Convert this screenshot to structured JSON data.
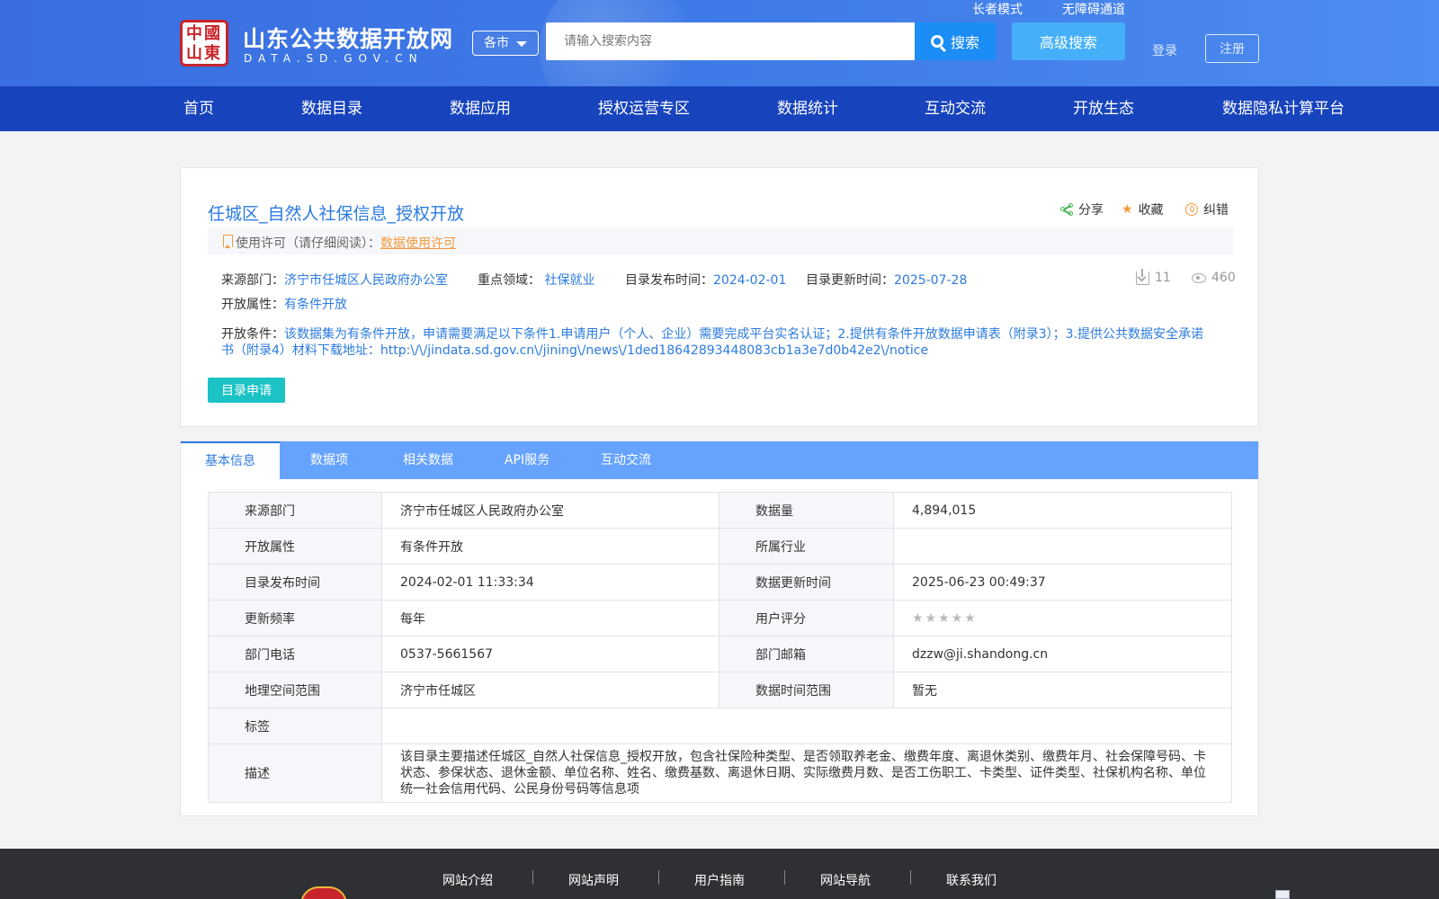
{
  "header": {
    "site_title": "山东公共数据开放网",
    "site_domain": "DATA.SD.GOV.CN",
    "logo_text": "中國山東",
    "city_select": "各市",
    "search_placeholder": "请输入搜索内容",
    "search_button": "搜索",
    "advanced_search": "高级搜索",
    "elder_mode": "长者模式",
    "accessibility": "无障碍通道",
    "login": "登录",
    "register": "注册",
    "brand_color": "#3f7ce8"
  },
  "nav": {
    "items": [
      "首页",
      "数据目录",
      "数据应用",
      "授权运营专区",
      "数据统计",
      "互动交流",
      "开放生态",
      "数据隐私计算平台"
    ],
    "color": "#1743bc"
  },
  "dataset": {
    "title": "任城区_自然人社保信息_授权开放",
    "actions": {
      "share": "分享",
      "favorite": "收藏",
      "report": "纠错"
    },
    "license_label": "使用许可（请仔细阅读）：",
    "license_link": "数据使用许可",
    "source_label": "来源部门：",
    "source_value": "济宁市任城区人民政府办公室",
    "domain_label": "重点领域：",
    "domain_value": "社保就业",
    "publish_label": "目录发布时间：",
    "publish_value": "2024-02-01",
    "update_label": "目录更新时间：",
    "update_value": "2025-07-28",
    "downloads": "11",
    "views": "460",
    "open_attr_label": "开放属性：",
    "open_attr_value": "有条件开放",
    "condition_label": "开放条件：",
    "condition_value": "该数据集为有条件开放，申请需要满足以下条件1.申请用户（个人、企业）需要完成平台实名认证；2.提供有条件开放数据申请表（附录3）；3.提供公共数据安全承诺书（附录4）材料下载地址：http:\\/\\/jindata.sd.gov.cn\\/jining\\/news\\/1ded18642893448083cb1a3e7d0b42e2\\/notice",
    "apply_button": "目录申请"
  },
  "tabs": [
    "基本信息",
    "数据项",
    "相关数据",
    "API服务",
    "互动交流"
  ],
  "info_table": {
    "rows": [
      {
        "k1": "来源部门",
        "v1": "济宁市任城区人民政府办公室",
        "k2": "数据量",
        "v2": "4,894,015"
      },
      {
        "k1": "开放属性",
        "v1": "有条件开放",
        "k2": "所属行业",
        "v2": ""
      },
      {
        "k1": "目录发布时间",
        "v1": "2024-02-01 11:33:34",
        "k2": "数据更新时间",
        "v2": "2025-06-23 00:49:37"
      },
      {
        "k1": "更新频率",
        "v1": "每年",
        "k2": "用户评分",
        "v2": "★★★★★"
      },
      {
        "k1": "部门电话",
        "v1": "0537-5661567",
        "k2": "部门邮箱",
        "v2": "dzzw@ji.shandong.cn"
      },
      {
        "k1": "地理空间范围",
        "v1": "济宁市任城区",
        "k2": "数据时间范围",
        "v2": "暂无"
      }
    ],
    "tag_label": "标签",
    "tag_value": "",
    "desc_label": "描述",
    "desc_value": "该目录主要描述任城区_自然人社保信息_授权开放，包含社保险种类型、是否领取养老金、缴费年度、离退休类别、缴费年月、社会保障号码、卡状态、参保状态、退休金额、单位名称、姓名、缴费基数、离退休日期、实际缴费月数、是否工伤职工、卡类型、证件类型、社保机构名称、单位统一社会信用代码、公民身份号码等信息项",
    "rating_stars": 0
  },
  "footer": {
    "links": [
      "网站介绍",
      "网站声明",
      "用户指南",
      "网站导航",
      "联系我们"
    ]
  }
}
